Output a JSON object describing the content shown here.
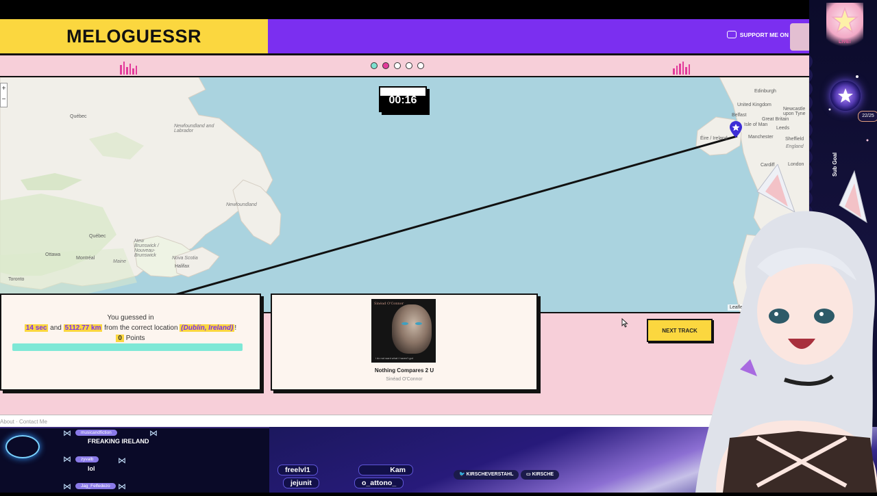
{
  "header": {
    "logo": "MELOGUESSR",
    "support_label": "SUPPORT ME ON"
  },
  "round_dots": {
    "total": 5,
    "current": 2
  },
  "map": {
    "timer": "00:16",
    "zoom_in": "+",
    "zoom_out": "−",
    "attribution": "Leaflet",
    "labels": {
      "quebec_region": "Québec",
      "newfoundland_labrador": "Newfoundland and Labrador",
      "newfoundland": "Newfoundland",
      "quebec_city": "Québec",
      "ottawa": "Ottawa",
      "montreal": "Montréal",
      "toronto": "Toronto",
      "new_brunswick": "New Brunswick / Nouveau-Brunswick",
      "nova_scotia": "Nova Scotia",
      "halifax": "Halifax",
      "maine": "Maine",
      "edinburgh": "Edinburgh",
      "united_kingdom": "United Kingdom",
      "belfast": "Belfast",
      "great_britain": "Great Britain",
      "isle_of_man": "Isle of Man",
      "leeds": "Leeds",
      "manchester": "Manchester",
      "newcastle": "Newcastle upon Tyne",
      "sheffield": "Sheffield",
      "england": "England",
      "ireland": "Éire / Ireland",
      "cardiff": "Cardiff",
      "london": "London"
    }
  },
  "result": {
    "line1": "You guessed in",
    "time": "14 sec",
    "and": "and",
    "distance": "5112.77 km",
    "from": "from the correct location",
    "location": "(Dublin, Ireland)",
    "end": "!",
    "points": "0",
    "points_label": "Points"
  },
  "track": {
    "cover_title": "Sinéad O'Connor",
    "cover_foot": "i do not want what i haven't got",
    "title": "Nothing Compares 2 U",
    "artist": "Sinéad O'Connor"
  },
  "next_button": "NEXT TRACK",
  "footer_strip": "About · Contact Me",
  "chat": [
    {
      "user": "musicandfiction",
      "message": "FREAKING IRELAND"
    },
    {
      "user": "zyvalb",
      "message": "lol"
    },
    {
      "user": "Jag_Felfedezo",
      "message": ""
    }
  ],
  "stream_names": [
    "freelvl1",
    "Kam",
    "jejunit",
    "o_attono_"
  ],
  "socials": [
    "KIRSCHEVERSTAHL",
    "KIRSCHE"
  ],
  "sidebar": {
    "live": "LIVE!",
    "sub_count": "22/25",
    "sub_goal": "Sub Goal"
  },
  "colors": {
    "brand_yellow": "#fbd73f",
    "brand_purple": "#7b2ff0",
    "pink_bg": "#f7cfd9",
    "accent_pink": "#e33b9b",
    "progress_teal": "#7ee8d6",
    "water": "#aad3df"
  }
}
